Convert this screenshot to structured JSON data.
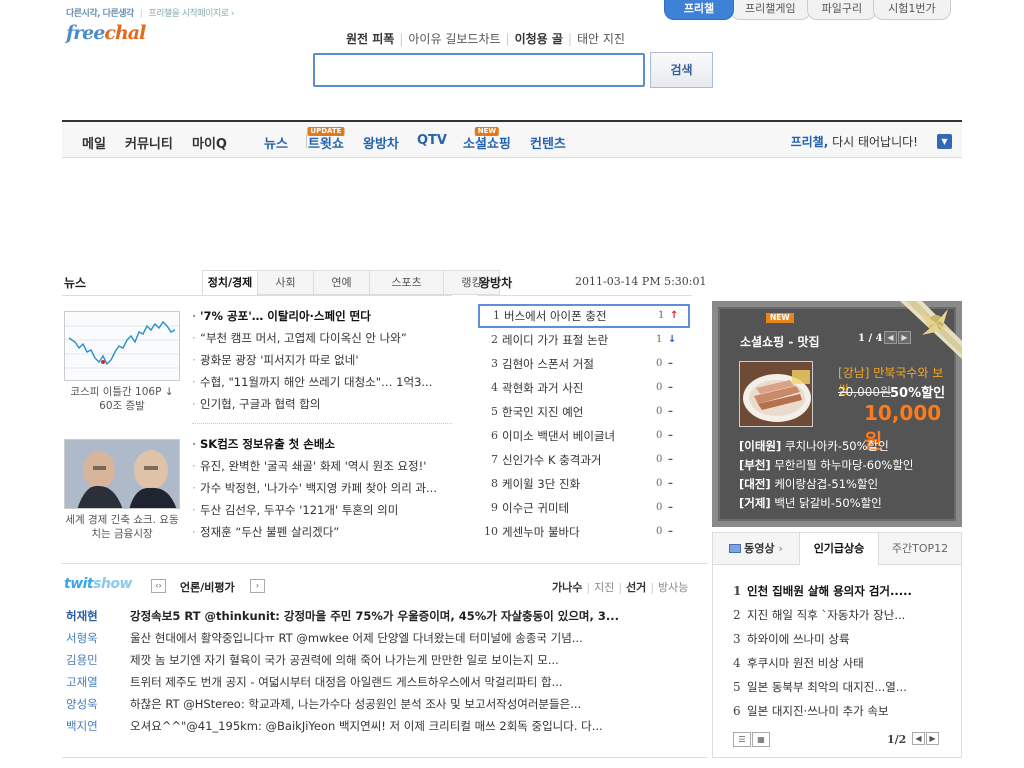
{
  "header": {
    "tagline_part1": "다른시각, 다른생각",
    "tagline_part2": "프리챌을 시작페이지로 ›",
    "logo_main": "free",
    "logo_accent": "chal"
  },
  "service_tabs": [
    {
      "label": "프리챌",
      "active": true
    },
    {
      "label": "프리챌게임"
    },
    {
      "label": "파일구리"
    },
    {
      "label": "시험1번가"
    }
  ],
  "search": {
    "hot_keywords": [
      "원전 피폭",
      "아이유 길보드차트",
      "이청용 골",
      "태안 지진"
    ],
    "placeholder": "",
    "button_label": "검색"
  },
  "gnb": {
    "items": [
      "메일",
      "커뮤니티",
      "마이Q",
      "뉴스",
      "트윗쇼",
      "왕방차",
      "QTV",
      "소셜쇼핑",
      "컨텐츠"
    ],
    "badge_update": "UPDATE",
    "badge_new": "NEW",
    "right_brand": "프리챌,",
    "right_text": " 다시 태어납니다!"
  },
  "news": {
    "title": "뉴스",
    "tabs": [
      "정치/경제",
      "사회",
      "연예",
      "스포츠",
      "랭킹"
    ],
    "block1": {
      "caption": "코스피 이틀간 106P ↓ 60조 증발",
      "headlines": [
        "'7% 공포'… 이탈리아·스페인 떤다",
        "“부천 캠프 머서, 고엽제 다이옥신 안 나와”",
        "광화문 광장 '피서지가 따로 없네'",
        "수협, \"11월까지 해안 쓰레기 대청소\"… 1억3...",
        "인기협, 구글과 협력 합의"
      ]
    },
    "block2": {
      "caption": "세계 경제 긴축 쇼크. 요동치는 금융시장",
      "headlines": [
        "SK컴즈 정보유출 첫 손배소",
        "유진, 완벽한 '굴곡 쇄골' 화제 '역시 원조 요정!'",
        "가수 박정현, '나가수' 백지영 카페 찾아 의리 과...",
        "두산 김선우, 두꾸수 '121개' 투혼의 의미",
        "정재훈 “두산 불펜 살리겠다”"
      ]
    }
  },
  "ranking": {
    "title": "왕방차",
    "date": "2011-03-14 PM 5:30:01",
    "items": [
      {
        "no": "1",
        "text": "버스에서 아이폰 충전",
        "count": "1",
        "trend": "up"
      },
      {
        "no": "2",
        "text": "레이디 가가 표절 논란",
        "count": "1",
        "trend": "down"
      },
      {
        "no": "3",
        "text": "김현아 스폰서 거절",
        "count": "0",
        "trend": "same"
      },
      {
        "no": "4",
        "text": "곽현화 과거 사진",
        "count": "0",
        "trend": "same"
      },
      {
        "no": "5",
        "text": "한국인 지진 예언",
        "count": "0",
        "trend": "same"
      },
      {
        "no": "6",
        "text": "이미소 백댄서 베이글녀",
        "count": "0",
        "trend": "same"
      },
      {
        "no": "7",
        "text": "신인가수 K 충격과거",
        "count": "0",
        "trend": "same"
      },
      {
        "no": "8",
        "text": "케이윌 3단 진화",
        "count": "0",
        "trend": "same"
      },
      {
        "no": "9",
        "text": "이수근 귀미테",
        "count": "0",
        "trend": "same"
      },
      {
        "no": "10",
        "text": "게센누마 불바다",
        "count": "0",
        "trend": "same"
      }
    ]
  },
  "shopping": {
    "badge": "NEW",
    "title": "소셜쇼핑 - 맛집",
    "page": "1 / 4",
    "area": "[강남] 만북국수와 보쌈",
    "original_price": "20,000원",
    "discount": "50%할인",
    "price": "10,000원",
    "deals": [
      {
        "region": "[이태원]",
        "text": " 쿠치나아카-50%할인"
      },
      {
        "region": "[부천]",
        "text": " 무한리필 하누마당-60%할인"
      },
      {
        "region": "[대전]",
        "text": " 케이랑삼겹-51%할인"
      },
      {
        "region": "[거제]",
        "text": " 백년 닭갈비-50%할인"
      }
    ]
  },
  "twitshow": {
    "logo_main": "twit",
    "logo_accent": "show",
    "category": "언론/비평가",
    "filters": [
      "가나수",
      "지진",
      "선거",
      "방사능"
    ],
    "rows": [
      {
        "name": "허재현",
        "text": "강정속보5 RT @thinkunit: 강정마을 주민 75%가 우울증이며, 45%가 자살충동이 있으며, 3..."
      },
      {
        "name": "서형욱",
        "text": "울산 현대에서 활약중입니다ㅠ RT @mwkee 어제 단양엘 다녀왔는데 터미널에 송종국 기념..."
      },
      {
        "name": "김용민",
        "text": "제깟 놈 보기엔 자기 혈육이 국가 공권력에 의해 죽어 나가는게 만만한 일로 보이는지 모..."
      },
      {
        "name": "고재열",
        "text": "트위터 제주도 번개 공지 - 여덟시부터 대정읍 아일랜드 게스트하우스에서 막걸리파티 합..."
      },
      {
        "name": "양성욱",
        "text": "하찮은 RT @HStereo: 학교과제, 나는가수다 성공원인 분석 조사 및 보고서작성여러분들은..."
      },
      {
        "name": "백지연",
        "text": "오셔요^^\"@41_195km: @BaikJiYeon 백지연씨! 저 이제 크리티컬 매쓰 2회독 중입니다. 다..."
      }
    ]
  },
  "video": {
    "tabs": [
      "동영상",
      "인기급상승",
      "주간TOP12"
    ],
    "items": [
      {
        "no": "1",
        "text": "인천 집배원 살해 용의자 검거....."
      },
      {
        "no": "2",
        "text": "지진 해일 직후 `자동차가 장난..."
      },
      {
        "no": "3",
        "text": "하와이에 쓰나미 상륙"
      },
      {
        "no": "4",
        "text": "후쿠시마 원전 비상 사태"
      },
      {
        "no": "5",
        "text": "일본 동북부 최악의 대지진...열..."
      },
      {
        "no": "6",
        "text": "일본 대지진·쓰나미 추가 속보"
      }
    ],
    "page": "1/2"
  },
  "colors": {
    "accent_blue": "#3d82d6",
    "orange": "#e07a1a",
    "shop_price": "#ff7a1a"
  }
}
